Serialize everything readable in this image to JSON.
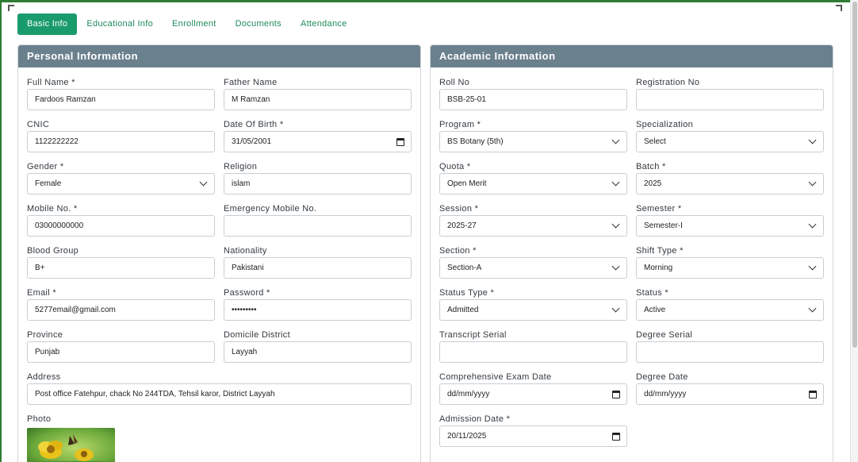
{
  "tabs": [
    {
      "label": "Basic Info",
      "active": true
    },
    {
      "label": "Educational Info",
      "active": false
    },
    {
      "label": "Enrollment",
      "active": false
    },
    {
      "label": "Documents",
      "active": false
    },
    {
      "label": "Attendance",
      "active": false
    }
  ],
  "personal": {
    "title": "Personal Information",
    "full_name": {
      "label": "Full Name *",
      "value": "Fardoos Ramzan"
    },
    "father_name": {
      "label": "Father Name",
      "value": "M Ramzan"
    },
    "cnic": {
      "label": "CNIC",
      "value": "1122222222"
    },
    "dob": {
      "label": "Date Of Birth *",
      "value": "31/05/2001"
    },
    "gender": {
      "label": "Gender *",
      "value": "Female"
    },
    "religion": {
      "label": "Religion",
      "value": "islam"
    },
    "mobile": {
      "label": "Mobile No. *",
      "value": "03000000000"
    },
    "emergency_mobile": {
      "label": "Emergency Mobile No.",
      "value": ""
    },
    "blood_group": {
      "label": "Blood Group",
      "value": "B+"
    },
    "nationality": {
      "label": "Nationality",
      "value": "Pakistani"
    },
    "email": {
      "label": "Email *",
      "value": "5277email@gmail.com"
    },
    "password": {
      "label": "Password *",
      "value": "•••••••••"
    },
    "province": {
      "label": "Province",
      "value": "Punjab"
    },
    "domicile": {
      "label": "Domicile District",
      "value": "Layyah"
    },
    "address": {
      "label": "Address",
      "value": "Post office Fatehpur, chack No 244TDA, Tehsil karor, District Layyah"
    },
    "photo": {
      "label": "Photo"
    }
  },
  "academic": {
    "title": "Academic Information",
    "roll_no": {
      "label": "Roll No",
      "value": "BSB-25-01"
    },
    "registration_no": {
      "label": "Registration No",
      "value": ""
    },
    "program": {
      "label": "Program *",
      "value": "BS Botany (5th)"
    },
    "specialization": {
      "label": "Specialization",
      "value": "Select"
    },
    "quota": {
      "label": "Quota *",
      "value": "Open Merit"
    },
    "batch": {
      "label": "Batch *",
      "value": "2025"
    },
    "session": {
      "label": "Session *",
      "value": "2025-27"
    },
    "semester": {
      "label": "Semester *",
      "value": "Semester-I"
    },
    "section": {
      "label": "Section *",
      "value": "Section-A"
    },
    "shift_type": {
      "label": "Shift Type *",
      "value": "Morning"
    },
    "status_type": {
      "label": "Status Type *",
      "value": "Admitted"
    },
    "status": {
      "label": "Status *",
      "value": "Active"
    },
    "transcript_serial": {
      "label": "Transcript Serial",
      "value": ""
    },
    "degree_serial": {
      "label": "Degree Serial",
      "value": ""
    },
    "comprehensive_exam_date": {
      "label": "Comprehensive Exam Date",
      "value": "dd/mm/yyyy"
    },
    "degree_date": {
      "label": "Degree Date",
      "value": "dd/mm/yyyy"
    },
    "admission_date": {
      "label": "Admission Date *",
      "value": "20/11/2025"
    }
  },
  "colors": {
    "accent": "#1a9b6c",
    "header": "#6b808d",
    "frame": "#2e7d32"
  },
  "icons": [
    "chevron-down-icon",
    "calendar-icon"
  ]
}
